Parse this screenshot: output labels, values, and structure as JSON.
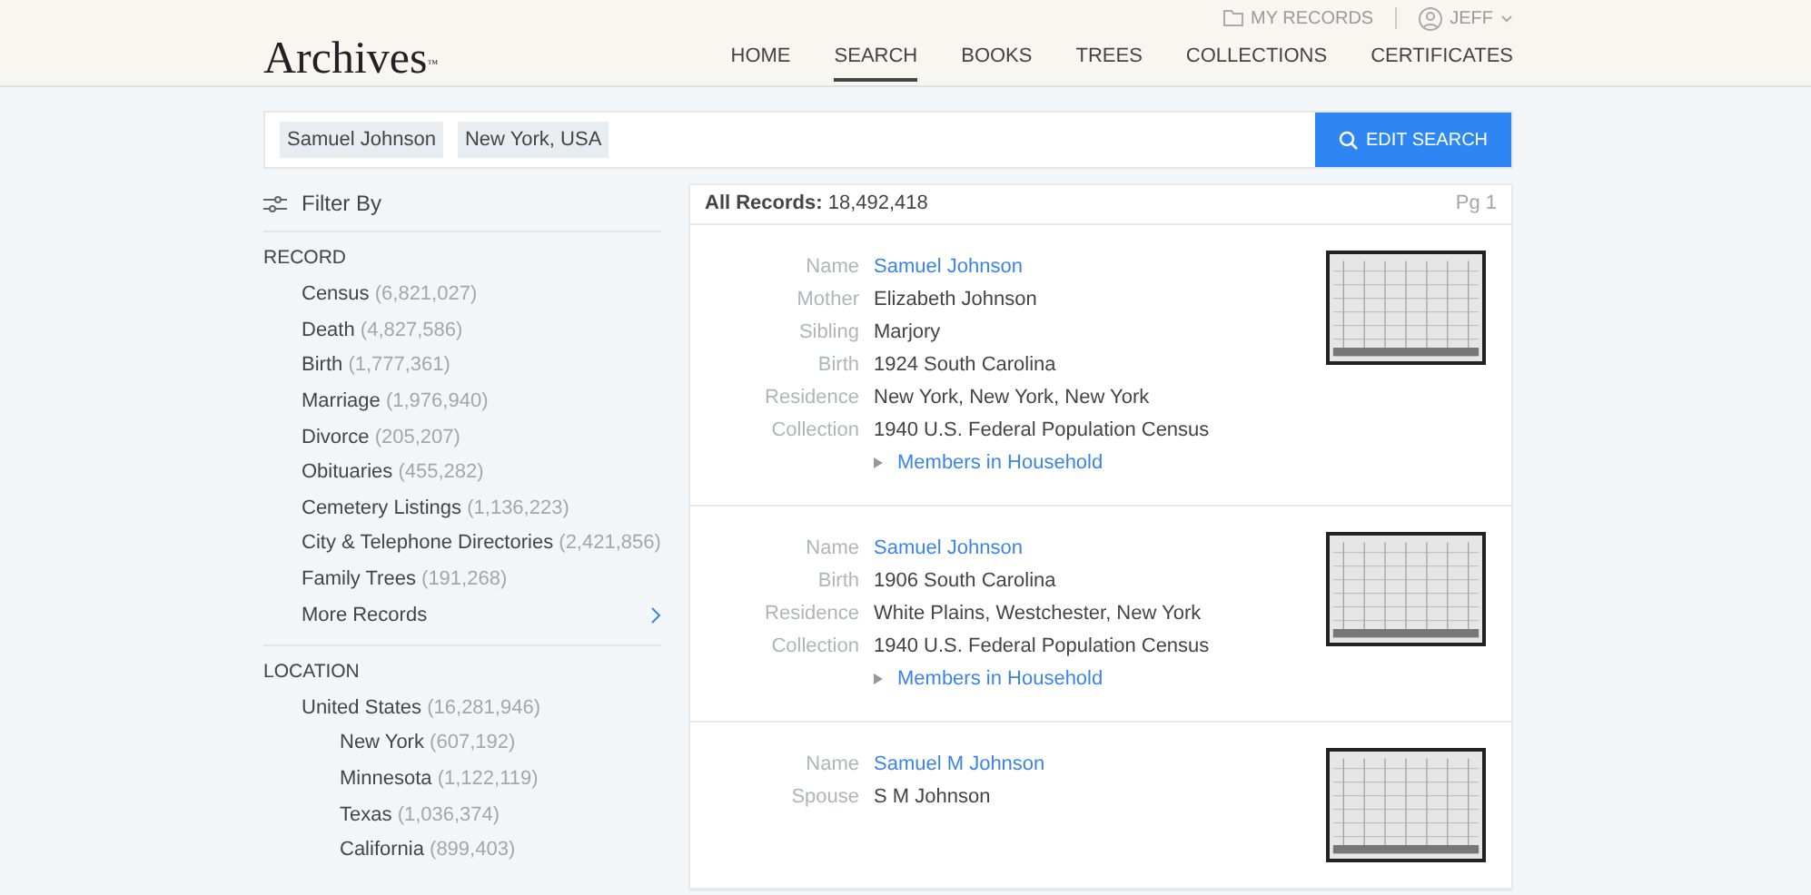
{
  "top_bar": {
    "links": [
      {
        "label": "MY RECORDS",
        "kind": "folder"
      },
      {
        "label": "JEFF",
        "kind": "user"
      }
    ]
  },
  "header": {
    "logo": "Archives",
    "logo_mark": "™",
    "nav": [
      {
        "label": "HOME",
        "selected": false
      },
      {
        "label": "SEARCH",
        "selected": true
      },
      {
        "label": "BOOKS",
        "selected": false
      },
      {
        "label": "TREES",
        "selected": false
      },
      {
        "label": "COLLECTIONS",
        "selected": false
      },
      {
        "label": "CERTIFICATES",
        "selected": false
      }
    ]
  },
  "search": {
    "terms": [
      "Samuel Johnson",
      "New York, USA"
    ],
    "button": "EDIT SEARCH"
  },
  "sidebar": {
    "title": "Filter By",
    "sections": [
      {
        "heading": "RECORD",
        "items": [
          {
            "label": "Census",
            "count": "(6,821,027)"
          },
          {
            "label": "Death",
            "count": "(4,827,586)"
          },
          {
            "label": "Birth",
            "count": "(1,777,361)"
          },
          {
            "label": "Marriage",
            "count": "(1,976,940)"
          },
          {
            "label": "Divorce",
            "count": "(205,207)"
          },
          {
            "label": "Obituaries",
            "count": "(455,282)"
          },
          {
            "label": "Cemetery Listings",
            "count": "(1,136,223)"
          },
          {
            "label": "City & Telephone Directories",
            "count": "(2,421,856)"
          },
          {
            "label": "Family Trees",
            "count": "(191,268)"
          },
          {
            "label": "More Records",
            "kind": "more"
          }
        ]
      },
      {
        "heading": "LOCATION",
        "items": [
          {
            "label": "United States",
            "count": "(16,281,946)",
            "children": [
              {
                "label": "New York",
                "count": "(607,192)"
              },
              {
                "label": "Minnesota",
                "count": "(1,122,119)"
              },
              {
                "label": "Texas",
                "count": "(1,036,374)"
              },
              {
                "label": "California",
                "count": "(899,403)"
              }
            ]
          }
        ]
      }
    ]
  },
  "results": {
    "summary_label": "All Records:",
    "summary_count": "18,492,418",
    "page": "Pg 1",
    "records": [
      {
        "fields": [
          {
            "label": "Name",
            "value": "Samuel Johnson",
            "kind": "link"
          },
          {
            "label": "Mother",
            "value": "Elizabeth Johnson"
          },
          {
            "label": "Sibling",
            "value": "Marjory"
          },
          {
            "label": "Birth",
            "value": "1924 South Carolina"
          },
          {
            "label": "Residence",
            "value": "New York, New York, New York"
          },
          {
            "label": "Collection",
            "value": "1940 U.S. Federal Population Census"
          }
        ],
        "more": "Members in Household"
      },
      {
        "fields": [
          {
            "label": "Name",
            "value": "Samuel Johnson",
            "kind": "link"
          },
          {
            "label": "Birth",
            "value": "1906 South Carolina"
          },
          {
            "label": "Residence",
            "value": "White Plains, Westchester, New York"
          },
          {
            "label": "Collection",
            "value": "1940 U.S. Federal Population Census"
          }
        ],
        "more": "Members in Household"
      },
      {
        "fields": [
          {
            "label": "Name",
            "value": "Samuel M Johnson",
            "kind": "link"
          },
          {
            "label": "Spouse",
            "value": "S M Johnson"
          }
        ]
      }
    ]
  }
}
